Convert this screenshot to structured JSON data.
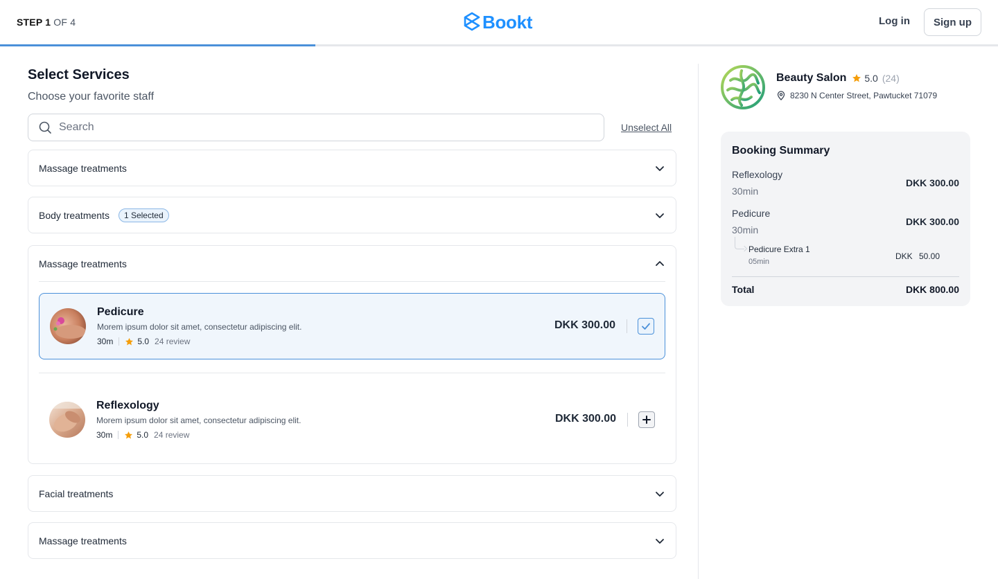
{
  "header": {
    "step_label": "STEP 1",
    "step_of": "OF 4",
    "brand": "Bookt",
    "login": "Log in",
    "signup": "Sign up",
    "progress": 0.316,
    "brand_color": "#1e90ff",
    "progress_color": "#4a90d9"
  },
  "main": {
    "title": "Select Services",
    "subtitle": "Choose your favorite staff",
    "search_placeholder": "Search",
    "unselect_all": "Unselect All",
    "sections": [
      {
        "label": "Massage treatments",
        "expanded": false
      },
      {
        "label": "Body treatments",
        "badge": "1 Selected",
        "expanded": false
      },
      {
        "label": "Massage treatments",
        "expanded": true
      },
      {
        "label": "Facial treatments",
        "expanded": false
      },
      {
        "label": "Massage treatments",
        "expanded": false
      }
    ],
    "services": [
      {
        "name": "Pedicure",
        "description": "Morem ipsum dolor sit amet, consectetur adipiscing elit.",
        "duration": "30m",
        "rating": "5.0",
        "reviews": "24 review",
        "price": "DKK 300.00",
        "selected": true
      },
      {
        "name": "Reflexology",
        "description": "Morem ipsum dolor sit amet, consectetur adipiscing elit.",
        "duration": "30m",
        "rating": "5.0",
        "reviews": "24 review",
        "price": "DKK 300.00",
        "selected": false
      }
    ]
  },
  "salon": {
    "name": "Beauty Salon",
    "rating": "5.0",
    "count": "(24)",
    "address": "8230 N Center Street, Pawtucket 71079"
  },
  "summary": {
    "title": "Booking Summary",
    "items": [
      {
        "name": "Reflexology",
        "duration": "30min",
        "price": "DKK 300.00"
      },
      {
        "name": "Pedicure",
        "duration": "30min",
        "price": "DKK 300.00"
      }
    ],
    "extra": {
      "name": "Pedicure Extra 1",
      "duration": "05min",
      "currency": "DKK",
      "amount": "50.00"
    },
    "total_label": "Total",
    "total_value": "DKK 800.00"
  }
}
